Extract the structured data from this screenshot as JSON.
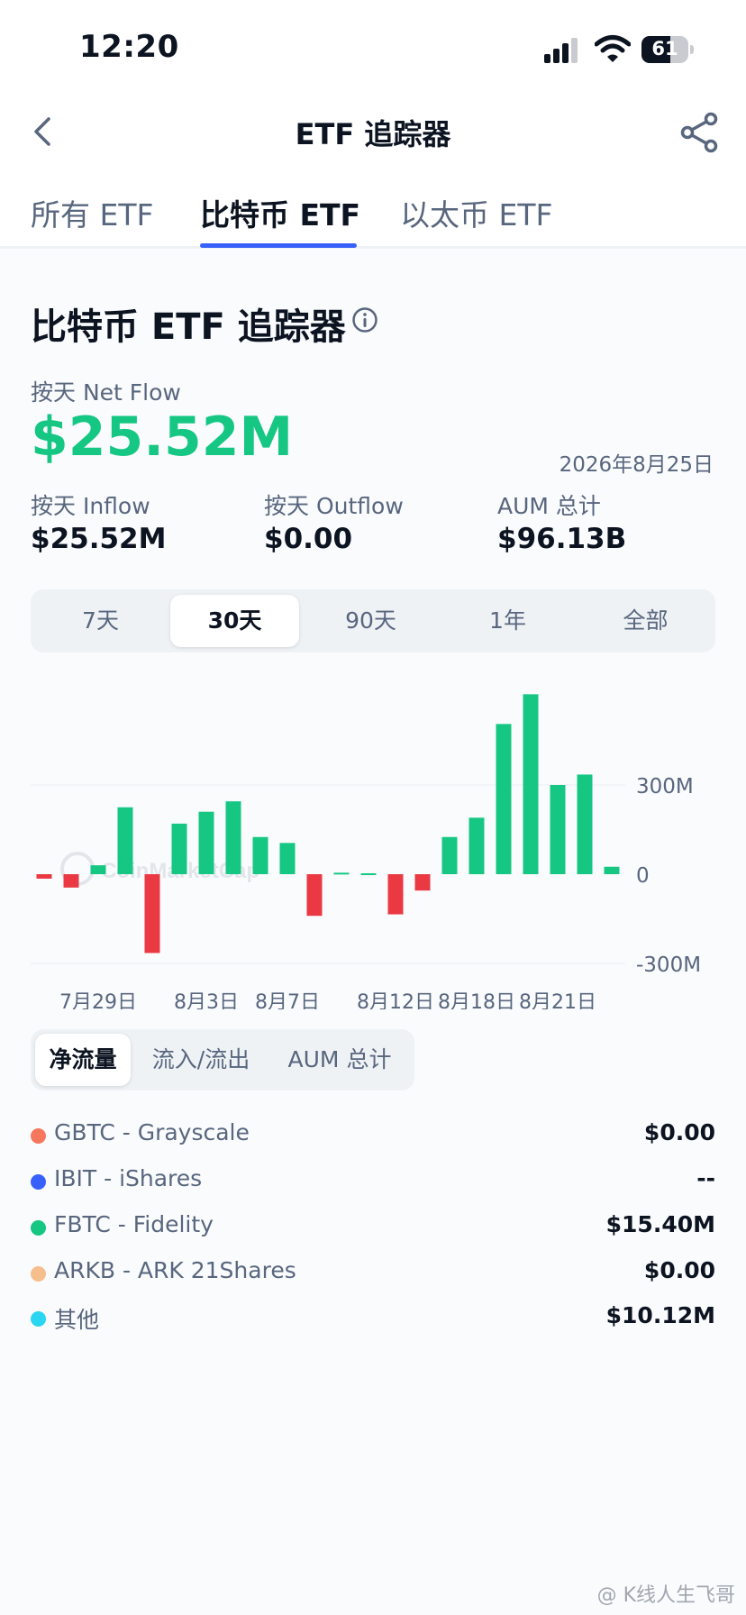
{
  "status_bar": {
    "time": "12:20",
    "battery": "61",
    "battery_level": 0.61
  },
  "header": {
    "title": "ETF 追踪器",
    "back_icon": "chevron-left-icon",
    "share_icon": "share-icon"
  },
  "tabs": [
    {
      "label": "所有 ETF",
      "active": false
    },
    {
      "label": "比特币 ETF",
      "active": true
    },
    {
      "label": "以太币 ETF",
      "active": false
    }
  ],
  "section": {
    "title": "比特币 ETF 追踪器",
    "info_icon": "info-icon"
  },
  "net_flow": {
    "label": "按天 Net Flow",
    "value": "$25.52M",
    "date": "2026年8月25日",
    "color": "#16c784"
  },
  "stats": [
    {
      "label": "按天 Inflow",
      "value": "$25.52M"
    },
    {
      "label": "按天 Outflow",
      "value": "$0.00"
    },
    {
      "label": "AUM 总计",
      "value": "$96.13B"
    }
  ],
  "range_selector": [
    {
      "label": "7天",
      "active": false
    },
    {
      "label": "30天",
      "active": true
    },
    {
      "label": "90天",
      "active": false
    },
    {
      "label": "1年",
      "active": false
    },
    {
      "label": "全部",
      "active": false
    }
  ],
  "chart_data": {
    "type": "bar",
    "y_tick_labels": [
      "300M",
      "0",
      "-300M"
    ],
    "y_ticks": [
      300,
      0,
      -300
    ],
    "ylim": [
      -300,
      600
    ],
    "x_tick_labels": [
      "7月29日",
      "8月3日",
      "8月7日",
      "8月12日",
      "8月18日",
      "8月21日"
    ],
    "x_tick_indices": [
      2,
      6,
      9,
      13,
      16,
      19
    ],
    "unit": "M",
    "values": [
      -15,
      -45,
      30,
      225,
      -265,
      170,
      210,
      245,
      125,
      105,
      -140,
      5,
      3,
      -135,
      -55,
      125,
      190,
      505,
      605,
      300,
      335,
      25
    ],
    "positive_color": "#16c784",
    "negative_color": "#ea3943",
    "grid": true,
    "watermark": "CoinMarketCap"
  },
  "sub_tabs": [
    {
      "label": "净流量",
      "active": true
    },
    {
      "label": "流入/流出",
      "active": false
    },
    {
      "label": "AUM 总计",
      "active": false
    }
  ],
  "breakdown": [
    {
      "name": "GBTC - Grayscale",
      "value": "$0.00",
      "color": "#f7775d"
    },
    {
      "name": "IBIT - iShares",
      "value": "--",
      "color": "#3861fb"
    },
    {
      "name": "FBTC - Fidelity",
      "value": "$15.40M",
      "color": "#16c784"
    },
    {
      "name": "ARKB - ARK 21Shares",
      "value": "$0.00",
      "color": "#f6be8d"
    },
    {
      "name": "其他",
      "value": "$10.12M",
      "color": "#2ad5f2"
    }
  ],
  "footer_watermark": "@ K线人生飞哥"
}
